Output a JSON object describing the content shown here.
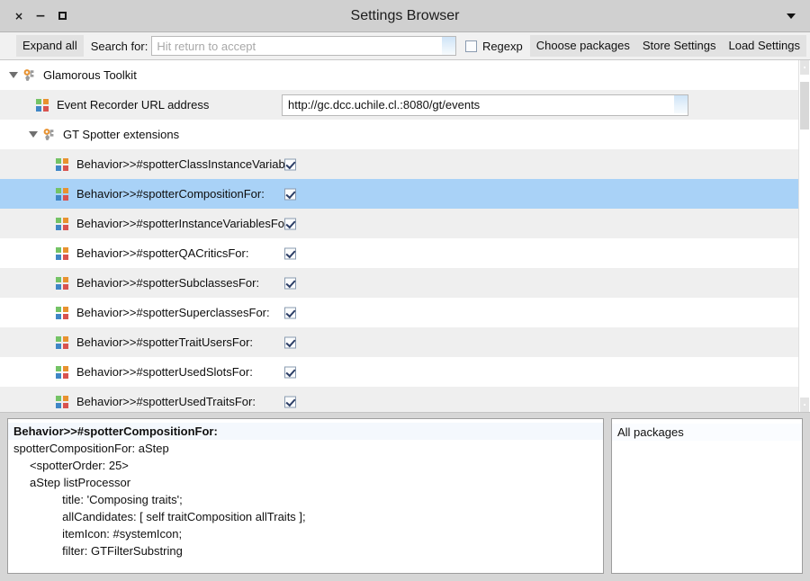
{
  "window": {
    "title": "Settings Browser",
    "controls": {
      "close": "×",
      "minimize": "−",
      "maximize_name": "maximize"
    },
    "menu_icon": "chevron-down-icon"
  },
  "toolbar": {
    "expand_all_label": "Expand all",
    "search_label": "Search for:",
    "search_value": "",
    "search_placeholder": "Hit return to accept",
    "regexp_label": "Regexp",
    "regexp_checked": false,
    "choose_packages_label": "Choose packages",
    "store_settings_label": "Store Settings",
    "load_settings_label": "Load Settings"
  },
  "tree": {
    "rows": [
      {
        "label": "Glamorous Toolkit",
        "icon": "wrench-icon",
        "kind": "group",
        "indent": 0,
        "expanded": true,
        "stripe": "plain",
        "selected": false,
        "control": "none"
      },
      {
        "label": "Event Recorder URL address",
        "icon": "grid-icon",
        "kind": "setting",
        "indent": 1,
        "expanded": null,
        "stripe": "alt",
        "selected": false,
        "control": "text",
        "value": "http://gc.dcc.uchile.cl.:8080/gt/events"
      },
      {
        "label": "GT Spotter extensions",
        "icon": "wrench-icon",
        "kind": "group",
        "indent": 2,
        "expanded": true,
        "stripe": "plain",
        "selected": false,
        "control": "none"
      },
      {
        "label": "Behavior>>#spotterClassInstanceVariable",
        "icon": "grid-icon",
        "kind": "setting",
        "indent": 3,
        "stripe": "alt",
        "selected": false,
        "control": "checkbox",
        "checked": true
      },
      {
        "label": "Behavior>>#spotterCompositionFor:",
        "icon": "grid-icon",
        "kind": "setting",
        "indent": 3,
        "stripe": "plain",
        "selected": true,
        "control": "checkbox",
        "checked": true
      },
      {
        "label": "Behavior>>#spotterInstanceVariablesFor:",
        "icon": "grid-icon",
        "kind": "setting",
        "indent": 3,
        "stripe": "alt",
        "selected": false,
        "control": "checkbox",
        "checked": true
      },
      {
        "label": "Behavior>>#spotterQACriticsFor:",
        "icon": "grid-icon",
        "kind": "setting",
        "indent": 3,
        "stripe": "plain",
        "selected": false,
        "control": "checkbox",
        "checked": true
      },
      {
        "label": "Behavior>>#spotterSubclassesFor:",
        "icon": "grid-icon",
        "kind": "setting",
        "indent": 3,
        "stripe": "alt",
        "selected": false,
        "control": "checkbox",
        "checked": true
      },
      {
        "label": "Behavior>>#spotterSuperclassesFor:",
        "icon": "grid-icon",
        "kind": "setting",
        "indent": 3,
        "stripe": "plain",
        "selected": false,
        "control": "checkbox",
        "checked": true
      },
      {
        "label": "Behavior>>#spotterTraitUsersFor:",
        "icon": "grid-icon",
        "kind": "setting",
        "indent": 3,
        "stripe": "alt",
        "selected": false,
        "control": "checkbox",
        "checked": true
      },
      {
        "label": "Behavior>>#spotterUsedSlotsFor:",
        "icon": "grid-icon",
        "kind": "setting",
        "indent": 3,
        "stripe": "plain",
        "selected": false,
        "control": "checkbox",
        "checked": true
      },
      {
        "label": "Behavior>>#spotterUsedTraitsFor:",
        "icon": "grid-icon",
        "kind": "setting",
        "indent": 3,
        "stripe": "alt",
        "selected": false,
        "control": "checkbox",
        "checked": true
      }
    ]
  },
  "code_pane": {
    "lines": [
      "Behavior>>#spotterCompositionFor:",
      "spotterCompositionFor: aStep",
      "     <spotterOrder: 25>",
      "     aStep listProcessor",
      "               title: 'Composing traits';",
      "               allCandidates: [ self traitComposition allTraits ];",
      "               itemIcon: #systemIcon;",
      "               filter: GTFilterSubstring"
    ]
  },
  "packages_pane": {
    "items": [
      "All packages"
    ]
  },
  "colors": {
    "selection": "#a9d2f7",
    "titlebar": "#d0d0d0",
    "toolbar": "#f1f1f1",
    "row_alt": "#efefef",
    "icon_green": "#74c365",
    "icon_orange": "#e8922f",
    "icon_blue": "#3f86c6",
    "icon_red": "#d9534f"
  }
}
